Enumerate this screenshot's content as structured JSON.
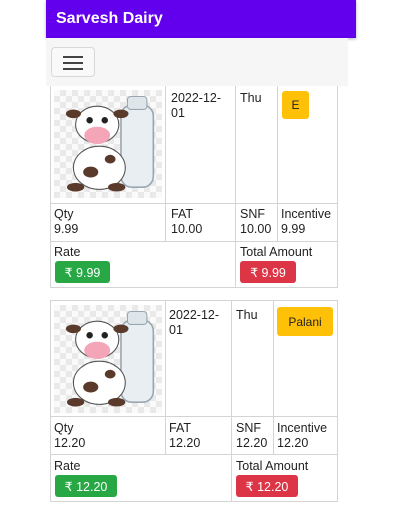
{
  "app": {
    "title": "Sarvesh Dairy"
  },
  "toolbar": {
    "menu_icon": "hamburger-menu-icon"
  },
  "records": [
    {
      "image_icon": "cow-milk-bottle-icon",
      "date": "2022-12-01",
      "date_line1": "2022-12-",
      "date_line2": "01",
      "day": "Thu",
      "shift": "E",
      "shift_color": "#ffc107",
      "qty_label": "Qty",
      "qty": "9.99",
      "fat_label": "FAT",
      "fat": "10.00",
      "snf_label": "SNF",
      "snf": "10.00",
      "incentive_label": "Incentive",
      "incentive": "9.99",
      "rate_label": "Rate",
      "rate": "₹ 9.99",
      "total_label": "Total Amount",
      "total": "₹ 9.99"
    },
    {
      "image_icon": "cow-milk-bottle-icon",
      "date": "2022-12-01",
      "date_line1": "2022-12-",
      "date_line2": "01",
      "day": "Thu",
      "shift": "Palani",
      "shift_color": "#ffc107",
      "qty_label": "Qty",
      "qty": "12.20",
      "fat_label": "FAT",
      "fat": "12.20",
      "snf_label": "SNF",
      "snf": "12.20",
      "incentive_label": "Incentive",
      "incentive": "12.20",
      "rate_label": "Rate",
      "rate": "₹ 12.20",
      "total_label": "Total Amount",
      "total": "₹ 12.20"
    }
  ],
  "colors": {
    "appbar": "#6200ee",
    "rate": "#28a745",
    "total": "#dc3545",
    "shift": "#ffc107"
  }
}
